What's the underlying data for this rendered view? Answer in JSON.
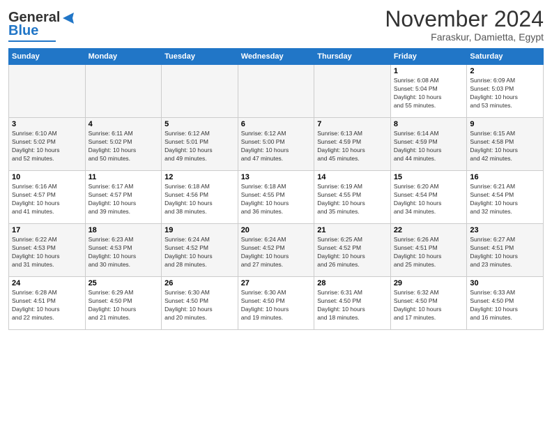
{
  "header": {
    "logo_general": "General",
    "logo_blue": "Blue",
    "month": "November 2024",
    "location": "Faraskur, Damietta, Egypt"
  },
  "calendar": {
    "days_of_week": [
      "Sunday",
      "Monday",
      "Tuesday",
      "Wednesday",
      "Thursday",
      "Friday",
      "Saturday"
    ],
    "weeks": [
      [
        {
          "day": "",
          "info": ""
        },
        {
          "day": "",
          "info": ""
        },
        {
          "day": "",
          "info": ""
        },
        {
          "day": "",
          "info": ""
        },
        {
          "day": "",
          "info": ""
        },
        {
          "day": "1",
          "info": "Sunrise: 6:08 AM\nSunset: 5:04 PM\nDaylight: 10 hours\nand 55 minutes."
        },
        {
          "day": "2",
          "info": "Sunrise: 6:09 AM\nSunset: 5:03 PM\nDaylight: 10 hours\nand 53 minutes."
        }
      ],
      [
        {
          "day": "3",
          "info": "Sunrise: 6:10 AM\nSunset: 5:02 PM\nDaylight: 10 hours\nand 52 minutes."
        },
        {
          "day": "4",
          "info": "Sunrise: 6:11 AM\nSunset: 5:02 PM\nDaylight: 10 hours\nand 50 minutes."
        },
        {
          "day": "5",
          "info": "Sunrise: 6:12 AM\nSunset: 5:01 PM\nDaylight: 10 hours\nand 49 minutes."
        },
        {
          "day": "6",
          "info": "Sunrise: 6:12 AM\nSunset: 5:00 PM\nDaylight: 10 hours\nand 47 minutes."
        },
        {
          "day": "7",
          "info": "Sunrise: 6:13 AM\nSunset: 4:59 PM\nDaylight: 10 hours\nand 45 minutes."
        },
        {
          "day": "8",
          "info": "Sunrise: 6:14 AM\nSunset: 4:59 PM\nDaylight: 10 hours\nand 44 minutes."
        },
        {
          "day": "9",
          "info": "Sunrise: 6:15 AM\nSunset: 4:58 PM\nDaylight: 10 hours\nand 42 minutes."
        }
      ],
      [
        {
          "day": "10",
          "info": "Sunrise: 6:16 AM\nSunset: 4:57 PM\nDaylight: 10 hours\nand 41 minutes."
        },
        {
          "day": "11",
          "info": "Sunrise: 6:17 AM\nSunset: 4:57 PM\nDaylight: 10 hours\nand 39 minutes."
        },
        {
          "day": "12",
          "info": "Sunrise: 6:18 AM\nSunset: 4:56 PM\nDaylight: 10 hours\nand 38 minutes."
        },
        {
          "day": "13",
          "info": "Sunrise: 6:18 AM\nSunset: 4:55 PM\nDaylight: 10 hours\nand 36 minutes."
        },
        {
          "day": "14",
          "info": "Sunrise: 6:19 AM\nSunset: 4:55 PM\nDaylight: 10 hours\nand 35 minutes."
        },
        {
          "day": "15",
          "info": "Sunrise: 6:20 AM\nSunset: 4:54 PM\nDaylight: 10 hours\nand 34 minutes."
        },
        {
          "day": "16",
          "info": "Sunrise: 6:21 AM\nSunset: 4:54 PM\nDaylight: 10 hours\nand 32 minutes."
        }
      ],
      [
        {
          "day": "17",
          "info": "Sunrise: 6:22 AM\nSunset: 4:53 PM\nDaylight: 10 hours\nand 31 minutes."
        },
        {
          "day": "18",
          "info": "Sunrise: 6:23 AM\nSunset: 4:53 PM\nDaylight: 10 hours\nand 30 minutes."
        },
        {
          "day": "19",
          "info": "Sunrise: 6:24 AM\nSunset: 4:52 PM\nDaylight: 10 hours\nand 28 minutes."
        },
        {
          "day": "20",
          "info": "Sunrise: 6:24 AM\nSunset: 4:52 PM\nDaylight: 10 hours\nand 27 minutes."
        },
        {
          "day": "21",
          "info": "Sunrise: 6:25 AM\nSunset: 4:52 PM\nDaylight: 10 hours\nand 26 minutes."
        },
        {
          "day": "22",
          "info": "Sunrise: 6:26 AM\nSunset: 4:51 PM\nDaylight: 10 hours\nand 25 minutes."
        },
        {
          "day": "23",
          "info": "Sunrise: 6:27 AM\nSunset: 4:51 PM\nDaylight: 10 hours\nand 23 minutes."
        }
      ],
      [
        {
          "day": "24",
          "info": "Sunrise: 6:28 AM\nSunset: 4:51 PM\nDaylight: 10 hours\nand 22 minutes."
        },
        {
          "day": "25",
          "info": "Sunrise: 6:29 AM\nSunset: 4:50 PM\nDaylight: 10 hours\nand 21 minutes."
        },
        {
          "day": "26",
          "info": "Sunrise: 6:30 AM\nSunset: 4:50 PM\nDaylight: 10 hours\nand 20 minutes."
        },
        {
          "day": "27",
          "info": "Sunrise: 6:30 AM\nSunset: 4:50 PM\nDaylight: 10 hours\nand 19 minutes."
        },
        {
          "day": "28",
          "info": "Sunrise: 6:31 AM\nSunset: 4:50 PM\nDaylight: 10 hours\nand 18 minutes."
        },
        {
          "day": "29",
          "info": "Sunrise: 6:32 AM\nSunset: 4:50 PM\nDaylight: 10 hours\nand 17 minutes."
        },
        {
          "day": "30",
          "info": "Sunrise: 6:33 AM\nSunset: 4:50 PM\nDaylight: 10 hours\nand 16 minutes."
        }
      ]
    ]
  }
}
